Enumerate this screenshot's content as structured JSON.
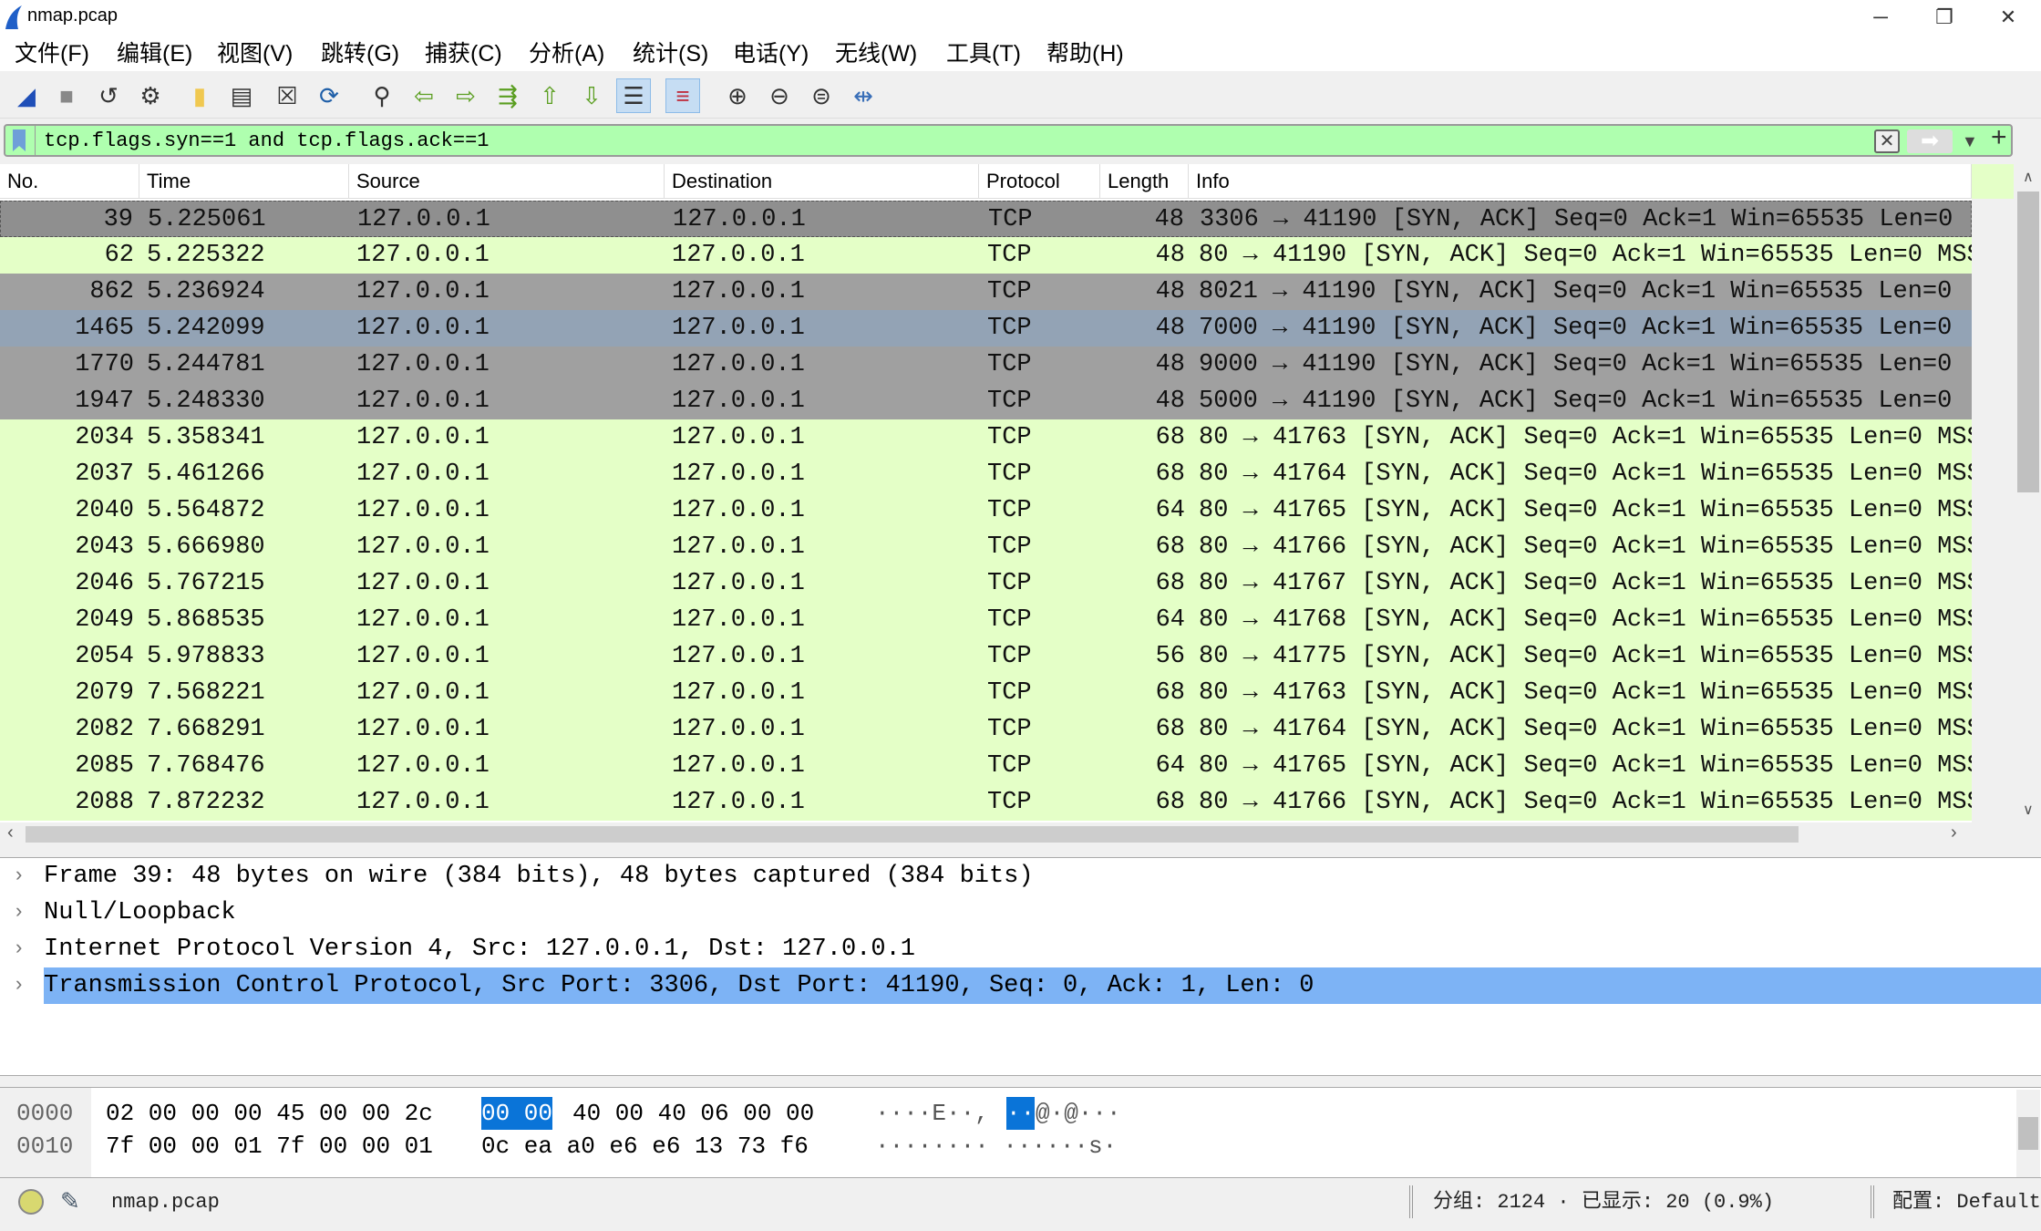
{
  "window": {
    "title": "nmap.pcap",
    "minimize": "─",
    "restore": "❐",
    "close": "✕"
  },
  "menu": [
    "文件(F)",
    "编辑(E)",
    "视图(V)",
    "跳转(G)",
    "捕获(C)",
    "分析(A)",
    "统计(S)",
    "电话(Y)",
    "无线(W)",
    "工具(T)",
    "帮助(H)"
  ],
  "toolbar": [
    "shark-fin-start-icon",
    "stop-icon",
    "restart-icon",
    "options-gear-icon",
    "open-folder-icon",
    "file-icon",
    "close-file-icon",
    "reload-icon",
    "find-icon",
    "back-arrow-icon",
    "forward-arrow-icon",
    "goto-packet-icon",
    "first-packet-icon",
    "last-packet-icon",
    "autoscroll-icon",
    "colorize-icon",
    "zoom-in-icon",
    "zoom-out-icon",
    "zoom-normal-icon",
    "resize-columns-icon"
  ],
  "filter": {
    "value": "tcp.flags.syn==1 and tcp.flags.ack==1",
    "add": "+"
  },
  "columns": [
    "No.",
    "Time",
    "Source",
    "Destination",
    "Protocol",
    "Length",
    "Info"
  ],
  "packets": [
    {
      "no": "39",
      "time": "5.225061",
      "src": "127.0.0.1",
      "dst": "127.0.0.1",
      "proto": "TCP",
      "len": "48",
      "info": "3306 → 41190 [SYN, ACK] Seq=0 Ack=1 Win=65535 Len=0",
      "color": "#8f8f8f"
    },
    {
      "no": "62",
      "time": "5.225322",
      "src": "127.0.0.1",
      "dst": "127.0.0.1",
      "proto": "TCP",
      "len": "48",
      "info": "80 → 41190 [SYN, ACK] Seq=0 Ack=1 Win=65535 Len=0 MSS",
      "color": "#e4ffc7"
    },
    {
      "no": "862",
      "time": "5.236924",
      "src": "127.0.0.1",
      "dst": "127.0.0.1",
      "proto": "TCP",
      "len": "48",
      "info": "8021 → 41190 [SYN, ACK] Seq=0 Ack=1 Win=65535 Len=0",
      "color": "#a0a0a0"
    },
    {
      "no": "1465",
      "time": "5.242099",
      "src": "127.0.0.1",
      "dst": "127.0.0.1",
      "proto": "TCP",
      "len": "48",
      "info": "7000 → 41190 [SYN, ACK] Seq=0 Ack=1 Win=65535 Len=0",
      "color": "#93a3b5"
    },
    {
      "no": "1770",
      "time": "5.244781",
      "src": "127.0.0.1",
      "dst": "127.0.0.1",
      "proto": "TCP",
      "len": "48",
      "info": "9000 → 41190 [SYN, ACK] Seq=0 Ack=1 Win=65535 Len=0",
      "color": "#a0a0a0"
    },
    {
      "no": "1947",
      "time": "5.248330",
      "src": "127.0.0.1",
      "dst": "127.0.0.1",
      "proto": "TCP",
      "len": "48",
      "info": "5000 → 41190 [SYN, ACK] Seq=0 Ack=1 Win=65535 Len=0",
      "color": "#a0a0a0"
    },
    {
      "no": "2034",
      "time": "5.358341",
      "src": "127.0.0.1",
      "dst": "127.0.0.1",
      "proto": "TCP",
      "len": "68",
      "info": "80 → 41763 [SYN, ACK] Seq=0 Ack=1 Win=65535 Len=0 MSS",
      "color": "#e4ffc7"
    },
    {
      "no": "2037",
      "time": "5.461266",
      "src": "127.0.0.1",
      "dst": "127.0.0.1",
      "proto": "TCP",
      "len": "68",
      "info": "80 → 41764 [SYN, ACK] Seq=0 Ack=1 Win=65535 Len=0 MSS",
      "color": "#e4ffc7"
    },
    {
      "no": "2040",
      "time": "5.564872",
      "src": "127.0.0.1",
      "dst": "127.0.0.1",
      "proto": "TCP",
      "len": "64",
      "info": "80 → 41765 [SYN, ACK] Seq=0 Ack=1 Win=65535 Len=0 MSS",
      "color": "#e4ffc7"
    },
    {
      "no": "2043",
      "time": "5.666980",
      "src": "127.0.0.1",
      "dst": "127.0.0.1",
      "proto": "TCP",
      "len": "68",
      "info": "80 → 41766 [SYN, ACK] Seq=0 Ack=1 Win=65535 Len=0 MSS",
      "color": "#e4ffc7"
    },
    {
      "no": "2046",
      "time": "5.767215",
      "src": "127.0.0.1",
      "dst": "127.0.0.1",
      "proto": "TCP",
      "len": "68",
      "info": "80 → 41767 [SYN, ACK] Seq=0 Ack=1 Win=65535 Len=0 MSS",
      "color": "#e4ffc7"
    },
    {
      "no": "2049",
      "time": "5.868535",
      "src": "127.0.0.1",
      "dst": "127.0.0.1",
      "proto": "TCP",
      "len": "64",
      "info": "80 → 41768 [SYN, ACK] Seq=0 Ack=1 Win=65535 Len=0 MSS",
      "color": "#e4ffc7"
    },
    {
      "no": "2054",
      "time": "5.978833",
      "src": "127.0.0.1",
      "dst": "127.0.0.1",
      "proto": "TCP",
      "len": "56",
      "info": "80 → 41775 [SYN, ACK] Seq=0 Ack=1 Win=65535 Len=0 MSS",
      "color": "#e4ffc7"
    },
    {
      "no": "2079",
      "time": "7.568221",
      "src": "127.0.0.1",
      "dst": "127.0.0.1",
      "proto": "TCP",
      "len": "68",
      "info": "80 → 41763 [SYN, ACK] Seq=0 Ack=1 Win=65535 Len=0 MSS",
      "color": "#e4ffc7"
    },
    {
      "no": "2082",
      "time": "7.668291",
      "src": "127.0.0.1",
      "dst": "127.0.0.1",
      "proto": "TCP",
      "len": "68",
      "info": "80 → 41764 [SYN, ACK] Seq=0 Ack=1 Win=65535 Len=0 MSS",
      "color": "#e4ffc7"
    },
    {
      "no": "2085",
      "time": "7.768476",
      "src": "127.0.0.1",
      "dst": "127.0.0.1",
      "proto": "TCP",
      "len": "64",
      "info": "80 → 41765 [SYN, ACK] Seq=0 Ack=1 Win=65535 Len=0 MSS",
      "color": "#e4ffc7"
    },
    {
      "no": "2088",
      "time": "7.872232",
      "src": "127.0.0.1",
      "dst": "127.0.0.1",
      "proto": "TCP",
      "len": "68",
      "info": "80 → 41766 [SYN, ACK] Seq=0 Ack=1 Win=65535 Len=0 MSS",
      "color": "#e4ffc7"
    }
  ],
  "details": [
    {
      "label": "Frame 39: 48 bytes on wire (384 bits), 48 bytes captured (384 bits)",
      "selected": false
    },
    {
      "label": "Null/Loopback",
      "selected": false
    },
    {
      "label": "Internet Protocol Version 4, Src: 127.0.0.1, Dst: 127.0.0.1",
      "selected": false
    },
    {
      "label": "Transmission Control Protocol, Src Port: 3306, Dst Port: 41190, Seq: 0, Ack: 1, Len: 0",
      "selected": true
    }
  ],
  "bytes": [
    {
      "offset": "0000",
      "hex_a": "02 00 00 00 45 00 00 2c",
      "hex_hl": "00 00",
      "hex_b": "40 00 40 06 00 00",
      "ascii_a": "····E··,",
      "ascii_hl": "··",
      "ascii_b": "@·@···"
    },
    {
      "offset": "0010",
      "hex_a": "7f 00 00 01 7f 00 00 01",
      "hex_hl": "",
      "hex_b": "0c ea a0 e6 e6 13 73 f6",
      "ascii_a": "········ ······s·",
      "ascii_hl": "",
      "ascii_b": ""
    }
  ],
  "status": {
    "file": "nmap.pcap",
    "counts": "分组: 2124 · 已显示: 20 (0.9%)",
    "profile": "配置: Default"
  },
  "colors": {
    "filter_ok": "#afffaf",
    "selection": "#7db3f5",
    "byte_highlight": "#0a74d8"
  }
}
